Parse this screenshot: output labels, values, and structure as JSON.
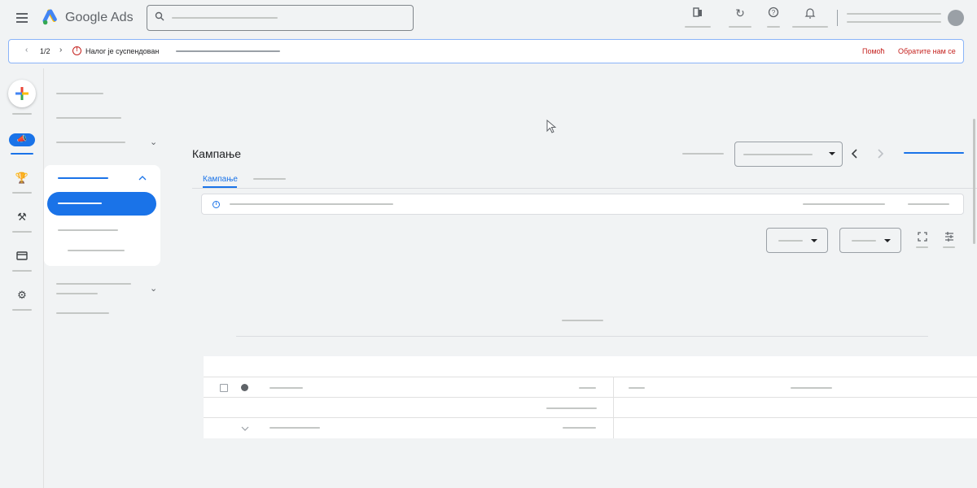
{
  "header": {
    "brand": "Google Ads",
    "icons": [
      "menu-icon",
      "google-ads-logo",
      "search-icon",
      "appearance-icon",
      "refresh-icon",
      "help-icon",
      "notifications-icon",
      "avatar"
    ]
  },
  "banner": {
    "counter": "1/2",
    "message": "Налог је суспендован",
    "help_link": "Помоћ",
    "contact_link": "Обратите нам се",
    "status_color": "#c5221f"
  },
  "left_rail": {
    "items": [
      "create",
      "campaigns-icon",
      "goals-icon",
      "tools-icon",
      "billing-icon",
      "admin-icon"
    ]
  },
  "main": {
    "title": "Кампање",
    "tabs": [
      {
        "label": "Кампање",
        "active": true
      }
    ]
  },
  "colors": {
    "accent": "#1a73e8",
    "background": "#f1f3f4",
    "alert": "#c5221f"
  }
}
